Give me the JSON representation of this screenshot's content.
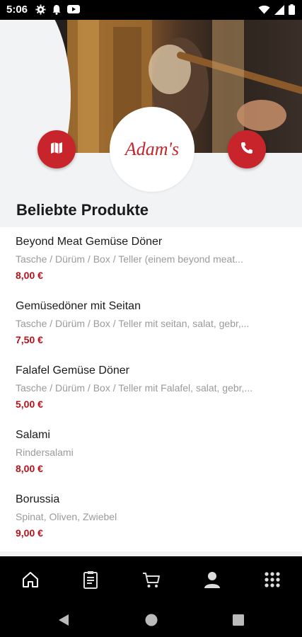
{
  "status_bar": {
    "time": "5:06",
    "left_icons": [
      "gear-icon",
      "notification-bell-icon",
      "youtube-icon"
    ],
    "right_icons": [
      "wifi-icon",
      "signal-icon",
      "battery-icon"
    ]
  },
  "header": {
    "logo_text": "Adam's",
    "map_button_icon": "map-icon",
    "phone_button_icon": "phone-icon",
    "accent_color": "#c8242b"
  },
  "section": {
    "title": "Beliebte Produkte"
  },
  "products": [
    {
      "name": "Beyond Meat Gemüse Döner",
      "description": "Tasche / Dürüm / Box / Teller (einem beyond meat...",
      "price": "8,00 €"
    },
    {
      "name": "Gemüsedöner mit Seitan",
      "description": "Tasche / Dürüm / Box / Teller mit seitan, salat, gebr,...",
      "price": "7,50 €"
    },
    {
      "name": "Falafel Gemüse Döner",
      "description": "Tasche / Dürüm / Box / Teller mit Falafel, salat, gebr,...",
      "price": "5,00 €"
    },
    {
      "name": "Salami",
      "description": "Rindersalami",
      "price": "8,00 €"
    },
    {
      "name": "Borussia",
      "description": "Spinat, Oliven, Zwiebel",
      "price": "9,00 €"
    }
  ],
  "bottom_nav": {
    "items": [
      "home-icon",
      "menu-card-icon",
      "cart-icon",
      "account-icon",
      "grid-menu-icon"
    ]
  },
  "system_nav": {
    "items": [
      "back-icon",
      "home-circle-icon",
      "recents-icon"
    ]
  }
}
